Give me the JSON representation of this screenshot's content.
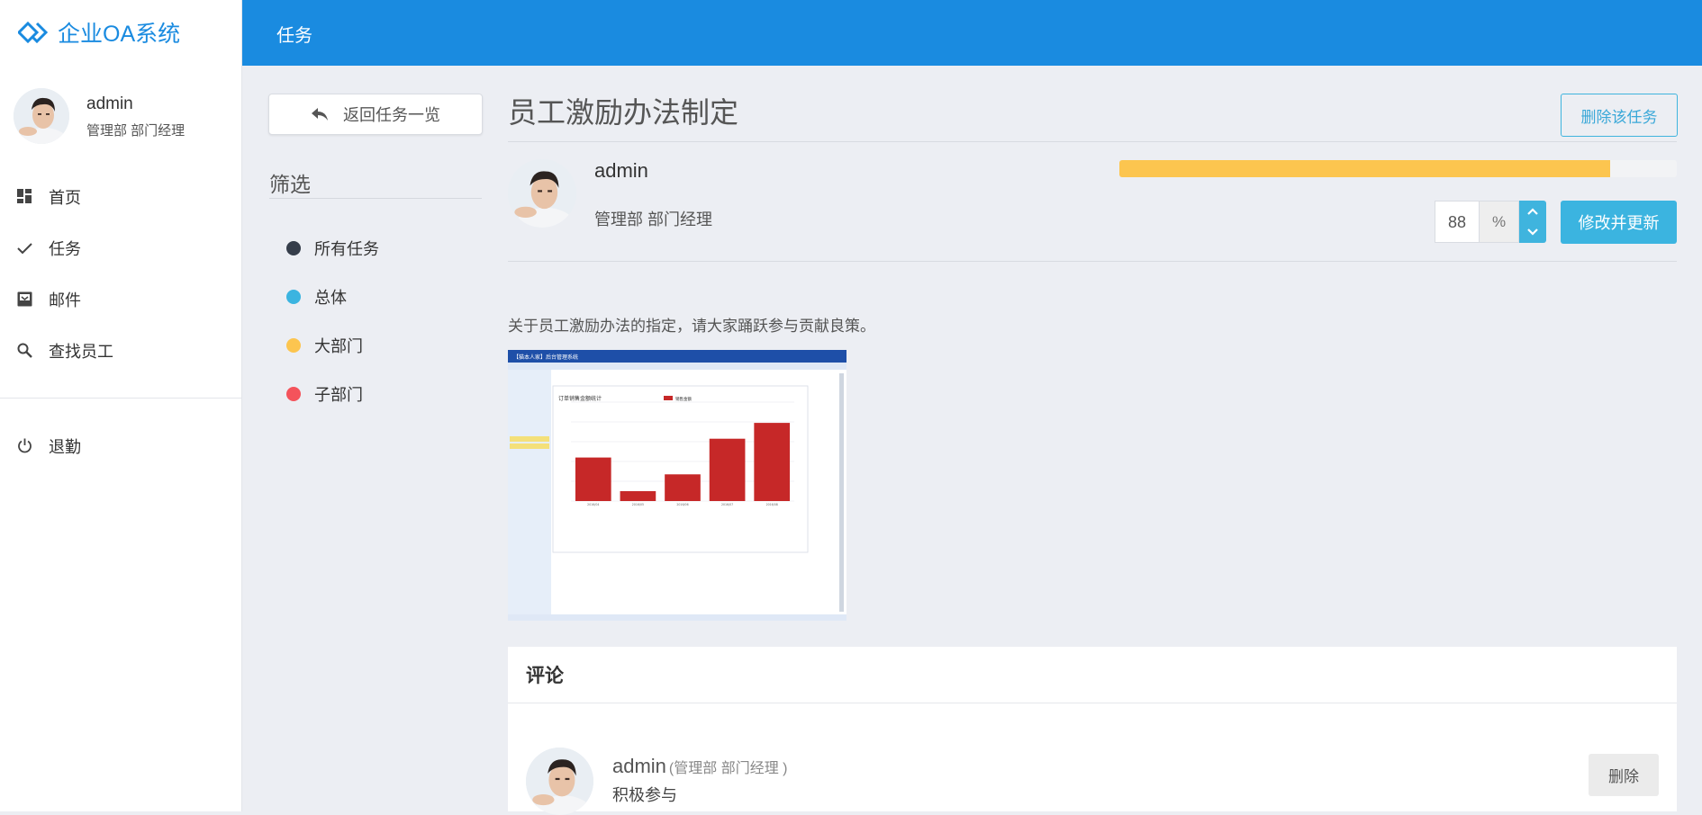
{
  "brand": {
    "name": "企业OA系统",
    "color": "#1a8be0",
    "logo_icon": "diamond-logo-icon"
  },
  "user": {
    "name": "admin",
    "role": "管理部 部门经理"
  },
  "nav": {
    "items": [
      {
        "label": "首页",
        "icon": "dashboard-icon"
      },
      {
        "label": "任务",
        "icon": "check-icon"
      },
      {
        "label": "邮件",
        "icon": "inbox-icon"
      },
      {
        "label": "查找员工",
        "icon": "search-icon"
      }
    ],
    "logout": {
      "label": "退勤",
      "icon": "power-icon"
    }
  },
  "header": {
    "title": "任务",
    "color": "#1a8be0"
  },
  "filter": {
    "back_label": "返回任务一览",
    "title": "筛选",
    "options": [
      {
        "label": "所有任务",
        "color": "#353d4a"
      },
      {
        "label": "总体",
        "color": "#3bb4e0"
      },
      {
        "label": "大部门",
        "color": "#fcc54f"
      },
      {
        "label": "子部门",
        "color": "#f4535b"
      }
    ]
  },
  "task": {
    "title": "员工激励办法制定",
    "delete_label": "删除该任务",
    "owner": {
      "name": "admin",
      "role": "管理部 部门经理"
    },
    "progress": {
      "value": 88,
      "unit": "%",
      "color": "#fcc54f"
    },
    "update_label": "修改并更新",
    "description": "关于员工激励办法的指定，请大家踊跃参与贡献良策。"
  },
  "comments": {
    "title": "评论",
    "items": [
      {
        "name": "admin",
        "role": "(管理部 部门经理 )",
        "text": "积极参与",
        "delete_label": "删除"
      }
    ]
  },
  "attachment": {
    "header_title": "【猫本人家】后台管理系统",
    "chart_title": "订单销售金额统计",
    "legend": "销售金额",
    "chart_data": {
      "type": "bar",
      "categories": [
        "2016/04",
        "2016/05",
        "2016/06",
        "2016/07",
        "2016/08"
      ],
      "values": [
        4400,
        1000,
        2700,
        6300,
        7900
      ],
      "ylim": [
        0,
        10000
      ],
      "color": "#c62828"
    }
  }
}
